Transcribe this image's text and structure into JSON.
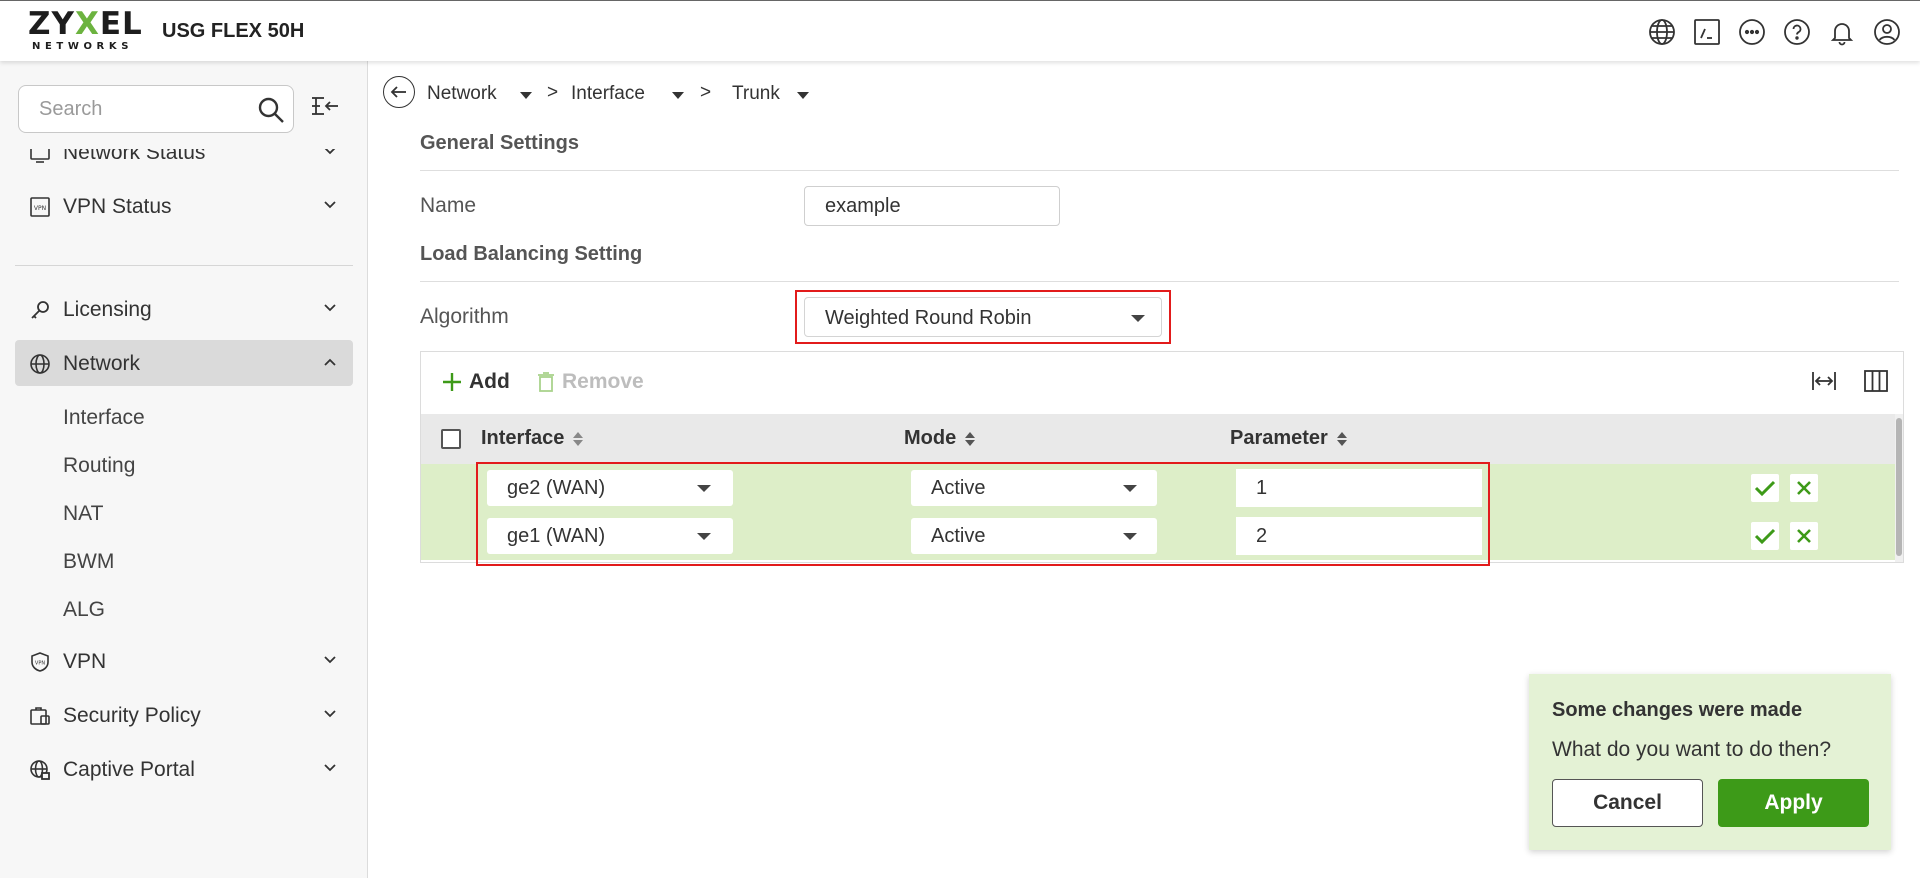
{
  "header": {
    "logo_main_1": "ZY",
    "logo_main_x": "X",
    "logo_main_2": "EL",
    "logo_sub": "NETWORKS",
    "product": "USG FLEX 50H",
    "icons": [
      "globe-icon",
      "console-icon",
      "more-icon",
      "help-icon",
      "bell-icon",
      "user-icon"
    ]
  },
  "sidebar": {
    "search_placeholder": "Search",
    "items": [
      {
        "label": "Network Status",
        "icon": "network-status-icon"
      },
      {
        "label": "VPN Status",
        "icon": "vpn-status-icon"
      },
      {
        "label": "Licensing",
        "icon": "key-icon"
      },
      {
        "label": "Network",
        "icon": "globe-icon",
        "expanded": true
      },
      {
        "label": "VPN",
        "icon": "shield-icon"
      },
      {
        "label": "Security Policy",
        "icon": "security-policy-icon"
      },
      {
        "label": "Captive Portal",
        "icon": "captive-portal-icon"
      }
    ],
    "network_subitems": [
      "Interface",
      "Routing",
      "NAT",
      "BWM",
      "ALG"
    ]
  },
  "breadcrumb": {
    "items": [
      "Network",
      "Interface",
      "Trunk"
    ],
    "separator": ">"
  },
  "general": {
    "title": "General Settings",
    "name_label": "Name",
    "name_value": "example"
  },
  "load_balancing": {
    "title": "Load Balancing Setting",
    "algorithm_label": "Algorithm",
    "algorithm_value": "Weighted Round Robin"
  },
  "table": {
    "add_label": "Add",
    "remove_label": "Remove",
    "columns": [
      "Interface",
      "Mode",
      "Parameter"
    ],
    "rows": [
      {
        "interface": "ge2 (WAN)",
        "mode": "Active",
        "parameter": "1"
      },
      {
        "interface": "ge1 (WAN)",
        "mode": "Active",
        "parameter": "2"
      }
    ]
  },
  "toast": {
    "title": "Some changes were made",
    "message": "What do you want to do then?",
    "cancel_label": "Cancel",
    "apply_label": "Apply"
  },
  "colors": {
    "accent_green": "#3d9a18",
    "row_highlight": "#ddeec8",
    "toast_bg": "#e4f2d5",
    "annotation_red": "#e21b1b"
  }
}
